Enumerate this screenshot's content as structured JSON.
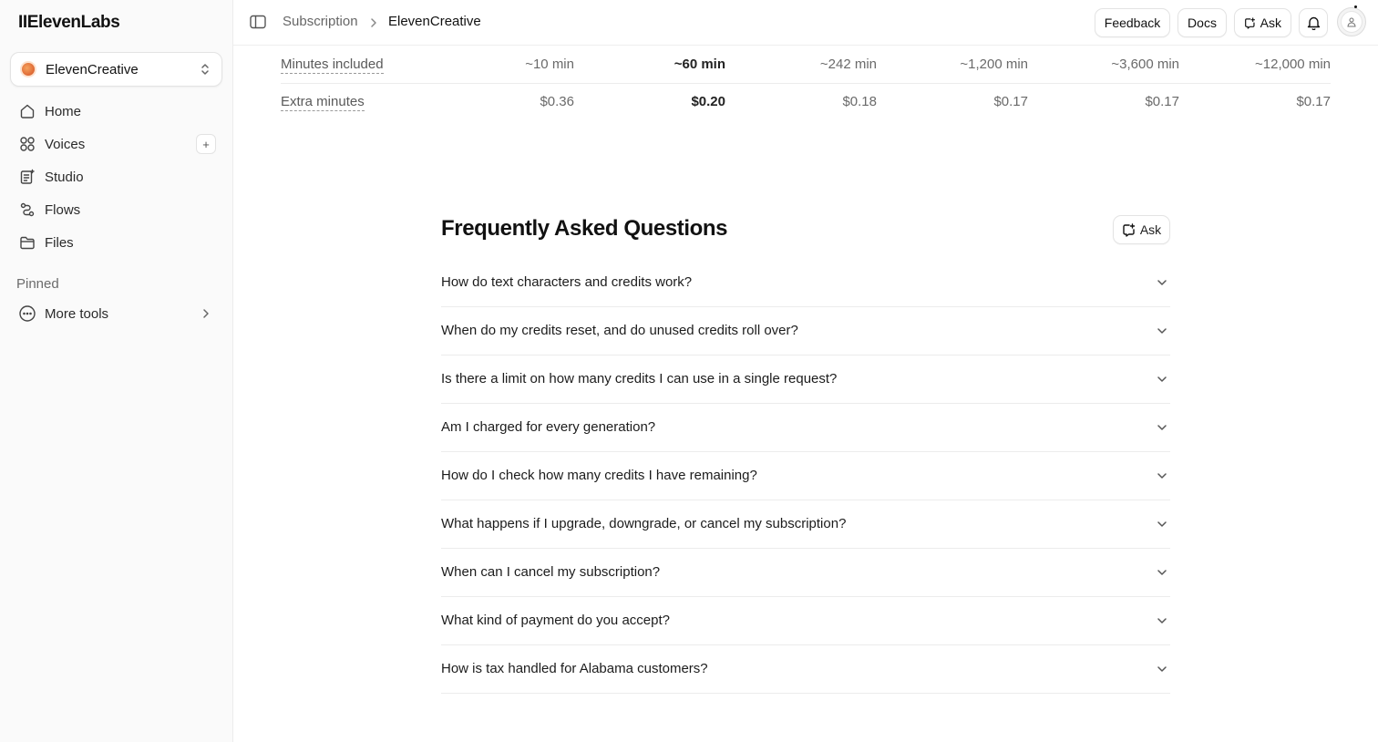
{
  "sidebar": {
    "logo": "IIElevenLabs",
    "workspace": "ElevenCreative",
    "items": [
      {
        "label": "Home",
        "icon": "home-icon"
      },
      {
        "label": "Voices",
        "icon": "voices-icon"
      },
      {
        "label": "Studio",
        "icon": "studio-icon"
      },
      {
        "label": "Flows",
        "icon": "flows-icon"
      },
      {
        "label": "Files",
        "icon": "files-icon"
      }
    ],
    "add_voice": "+",
    "pinned_label": "Pinned",
    "more_tools": "More tools"
  },
  "topbar": {
    "breadcrumb": [
      "Subscription",
      "ElevenCreative"
    ],
    "feedback": "Feedback",
    "docs": "Docs",
    "ask": "Ask"
  },
  "pricing": {
    "rows": [
      {
        "label": "Minutes included",
        "values": [
          "~10 min",
          "~60 min",
          "~242 min",
          "~1,200 min",
          "~3,600 min",
          "~12,000 min"
        ]
      },
      {
        "label": "Extra minutes",
        "values": [
          "$0.36",
          "$0.20",
          "$0.18",
          "$0.17",
          "$0.17",
          "$0.17"
        ]
      }
    ],
    "highlight_column": 1
  },
  "faq": {
    "title": "Frequently Asked Questions",
    "ask": "Ask",
    "questions": [
      "How do text characters and credits work?",
      "When do my credits reset, and do unused credits roll over?",
      "Is there a limit on how many credits I can use in a single request?",
      "Am I charged for every generation?",
      "How do I check how many credits I have remaining?",
      "What happens if I upgrade, downgrade, or cancel my subscription?",
      "When can I cancel my subscription?",
      "What kind of payment do you accept?",
      "How is tax handled for Alabama customers?"
    ]
  },
  "colors": {
    "text": "#1c1c1c",
    "muted": "#6a6a6a",
    "border": "#ececec",
    "sidebar_bg": "#fafafa"
  }
}
